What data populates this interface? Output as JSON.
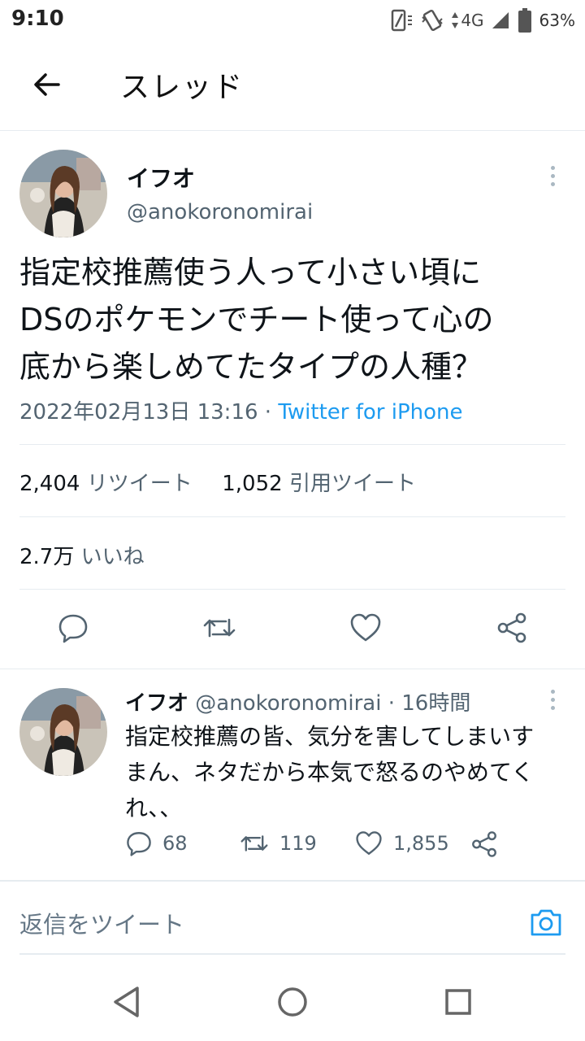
{
  "status_bar": {
    "time": "9:10",
    "network": "4G",
    "battery": "63%"
  },
  "header": {
    "title": "スレッド",
    "back_icon": "arrow-left-icon"
  },
  "tweet": {
    "author_name": "イフオ",
    "author_handle": "@anokoronomirai",
    "text_lines": [
      "指定校推薦使う人って小さい頃に",
      "DSのポケモンでチート使って心の",
      "底から楽しめてたタイプの人種？"
    ],
    "date": "2022年02月13日 13:16",
    "separator": "·",
    "source": "Twitter for iPhone",
    "retweet_count": "2,404",
    "retweet_label": "リツイート",
    "quote_count": "1,052",
    "quote_label": "引用ツイート",
    "like_count": "2.7万",
    "like_label": "いいね"
  },
  "reply": {
    "author_name": "イフオ",
    "author_handle": "@anokoronomirai",
    "time": "· 16時間",
    "text_lines": [
      "指定校推薦の皆、気分を害してしまいす",
      "まん、ネタだから本気で怒るのやめてく",
      "れ、、"
    ],
    "reply_count": "68",
    "retweet_count": "119",
    "like_count": "1,855"
  },
  "compose": {
    "placeholder": "返信をツイート"
  },
  "colors": {
    "accent": "#1d9bf0",
    "secondary_text": "#536471",
    "divider": "#e6ecf0"
  }
}
